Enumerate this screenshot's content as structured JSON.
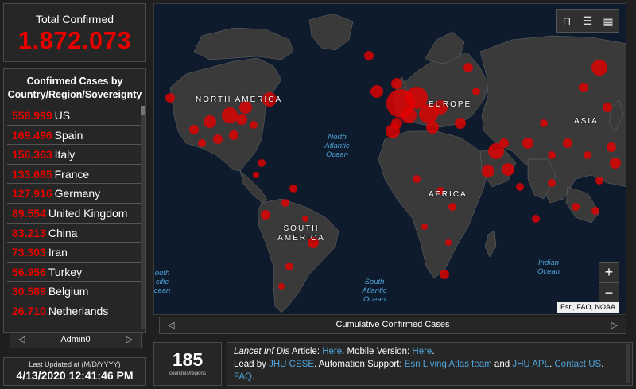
{
  "total": {
    "label": "Total Confirmed",
    "value": "1.872.073"
  },
  "list": {
    "header": "Confirmed Cases by Country/Region/Sovereignty",
    "rows": [
      {
        "count": "558.999",
        "name": "US"
      },
      {
        "count": "169.496",
        "name": "Spain"
      },
      {
        "count": "156.363",
        "name": "Italy"
      },
      {
        "count": "133.685",
        "name": "France"
      },
      {
        "count": "127.916",
        "name": "Germany"
      },
      {
        "count": "89.554",
        "name": "United Kingdom"
      },
      {
        "count": "83.213",
        "name": "China"
      },
      {
        "count": "73.303",
        "name": "Iran"
      },
      {
        "count": "56.956",
        "name": "Turkey"
      },
      {
        "count": "30.589",
        "name": "Belgium"
      },
      {
        "count": "26.710",
        "name": "Netherlands"
      }
    ],
    "tab": {
      "prev": "◁",
      "label": "Admin0",
      "next": "▷"
    }
  },
  "updated": {
    "label": "Last Updated at (M/D/YYYY)",
    "value": "4/13/2020 12:41:46 PM"
  },
  "map": {
    "labels": {
      "north_america": "NORTH AMERICA",
      "south_america": "SOUTH AMERICA",
      "europe": "EUROPE",
      "africa": "AFRICA",
      "asia": "ASIA"
    },
    "oceans": {
      "north_atlantic": "North Atlantic Ocean",
      "south_atlantic": "South Atlantic Ocean",
      "indian": "Indian Ocean",
      "south_pacific": "outh cific cean"
    },
    "tools": {
      "bookmark": "bookmark-icon",
      "list": "list-icon",
      "qr": "qr-code-icon"
    },
    "zoom": {
      "in": "+",
      "out": "−"
    },
    "attribution": "Esri, FAO, NOAA",
    "colors": {
      "ocean": "#0e1b2d",
      "land": "#3a3a3a",
      "bubble": "#e60000"
    }
  },
  "map_footer": {
    "prev": "◁",
    "label": "Cumulative Confirmed Cases",
    "next": "▷"
  },
  "countries_count": {
    "value": "185",
    "label": "countries/regions"
  },
  "info": {
    "line1_italic": "Lancet Inf Dis",
    "line1_text": " Article: ",
    "here1": "Here",
    "mobile_text": ". Mobile Version: ",
    "here2": "Here",
    "dot1": ".",
    "line2_text": "Lead by ",
    "jhu_csse": "JHU CSSE",
    "auto_text": ". Automation Support: ",
    "living_atlas": "Esri Living Atlas team",
    "and_text": " and ",
    "jhu_apl": "JHU APL",
    "dot2": ". ",
    "contact": "Contact US",
    "dot3": ". ",
    "faq": "FAQ",
    "dot4": "."
  }
}
